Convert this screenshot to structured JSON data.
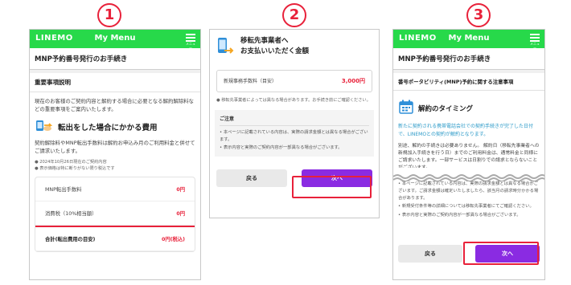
{
  "steps": [
    "1",
    "2",
    "3"
  ],
  "header": {
    "logo": "LINEMO",
    "menu_title": "My Menu",
    "menu_icon_label": "メニュー"
  },
  "screen1": {
    "page_title": "MNP予約番号発行のお手続き",
    "section_title": "重要事項説明",
    "intro": "現在のお客様のご契約内容と解約する場合に必要となる解約解除料などの重要事項をご案内いたします。",
    "fee_heading": "転出をした場合にかかる費用",
    "fee_desc": "契約解除料やMNP転出手数料は解約お申込み月のご利用料金と併せてご請求いたします。",
    "notes": [
      "2024年10月26日現在のご契約内容",
      "表示価格は特に断りがない限り税込です"
    ],
    "fees": [
      {
        "label": "MNP転出手数料",
        "value": "0円"
      },
      {
        "label": "消費税（10%相当額）",
        "value": "0円"
      },
      {
        "label": "合計(転出費用の目安)",
        "value": "0円(税込)"
      }
    ]
  },
  "screen2": {
    "title_line1": "移転先事業者へ",
    "title_line2": "お支払いいただく金額",
    "amount_label": "新規事務手数料（目安）",
    "amount_value": "3,000円",
    "amount_note": "移転先事業者によっては異なる場合があります。お手続き前にご確認ください。",
    "caution_heading": "ご注意",
    "caution_items": [
      "本ページに記載されている内容は、実際の請求金額とは異なる場合がございます。",
      "表示内容と実際のご契約内容が一部異なる場合がございます。"
    ],
    "back_label": "戻る",
    "next_label": "次へ"
  },
  "screen3": {
    "page_title": "MNP予約番号発行のお手続き",
    "section_title": "番号ポータビリティ(MNP)予約に関する注意事項",
    "heading": "解約のタイミング",
    "green_text": "新たに契約される携帯電話会社での契約手続きが完了した日付で、LINEMOとの契約が解約となります。",
    "body": "別途、解約の手続きは必要ありません。 解約日（移転先事業者への新規加入手続きを行う日）までのご利用料金は、通常料金と同様にご請求いたします。一部サービスは日割りでの請求とならないことがございます。",
    "lower_items": [
      "本ページに記載されている内容は、実際の請求金額とは異なる場合がございます。ご請求金額は確定いたしましたら、該当月の請求時分かかる場合があります。",
      "新規受付条件等の詳細については移転先事業者にてご確認ください。",
      "表示内容と実際のご契約内容が一部異なる場合がございます。"
    ],
    "back_label": "戻る",
    "next_label": "次へ"
  }
}
